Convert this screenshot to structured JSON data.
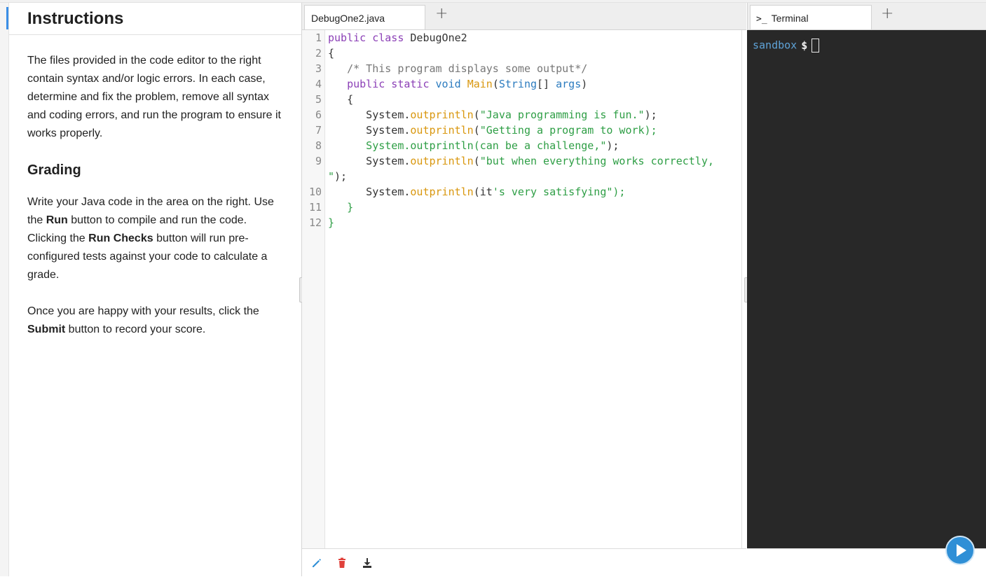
{
  "instructions": {
    "title": "Instructions",
    "intro": "The files provided in the code editor to the right contain syntax and/or logic errors. In each case, determine and fix the problem, remove all syntax and coding errors, and run the program to ensure it works properly.",
    "grading_title": "Grading",
    "grading_p1_a": "Write your Java code in the area on the right. Use the ",
    "grading_p1_run": "Run",
    "grading_p1_b": " button to compile and run the code. Clicking the ",
    "grading_p1_checks": "Run Checks",
    "grading_p1_c": " button will run pre-configured tests against your code to calculate a grade.",
    "grading_p2_a": "Once you are happy with your results, click the ",
    "grading_p2_submit": "Submit",
    "grading_p2_b": " button to record your score."
  },
  "editor": {
    "tab_label": "DebugOne2.java",
    "add_tab": "+",
    "lines": [
      {
        "n": "1",
        "tokens": [
          {
            "c": "kw",
            "t": "public class "
          },
          {
            "c": "pl",
            "t": "DebugOne2"
          }
        ]
      },
      {
        "n": "2",
        "tokens": [
          {
            "c": "pl",
            "t": "{"
          }
        ]
      },
      {
        "n": "3",
        "tokens": [
          {
            "c": "cm",
            "t": "   /* This program displays some output*/"
          }
        ]
      },
      {
        "n": "4",
        "tokens": [
          {
            "c": "kw",
            "t": "   public static "
          },
          {
            "c": "ty",
            "t": "void "
          },
          {
            "c": "fn",
            "t": "Main"
          },
          {
            "c": "pl",
            "t": "("
          },
          {
            "c": "ty",
            "t": "String"
          },
          {
            "c": "pl",
            "t": "[] "
          },
          {
            "c": "ty",
            "t": "args"
          },
          {
            "c": "pl",
            "t": ")"
          }
        ]
      },
      {
        "n": "5",
        "tokens": [
          {
            "c": "pl",
            "t": "   {"
          }
        ]
      },
      {
        "n": "6",
        "tokens": [
          {
            "c": "pl",
            "t": "      System."
          },
          {
            "c": "fn",
            "t": "outprintln"
          },
          {
            "c": "pl",
            "t": "("
          },
          {
            "c": "st",
            "t": "\"Java programming is fun.\""
          },
          {
            "c": "pl",
            "t": ");"
          }
        ]
      },
      {
        "n": "7",
        "tokens": [
          {
            "c": "pl",
            "t": "      System."
          },
          {
            "c": "fn",
            "t": "outprintln"
          },
          {
            "c": "pl",
            "t": "("
          },
          {
            "c": "st",
            "t": "\"Getting a program to work);"
          }
        ]
      },
      {
        "n": "8",
        "tokens": [
          {
            "c": "st",
            "t": "      System.outprintln(can be a challenge,\""
          },
          {
            "c": "pl",
            "t": ");"
          }
        ]
      },
      {
        "n": "9",
        "tokens": [
          {
            "c": "pl",
            "t": "      System."
          },
          {
            "c": "fn",
            "t": "outprintln"
          },
          {
            "c": "pl",
            "t": "("
          },
          {
            "c": "st",
            "t": "\"but when everything works correctly,"
          }
        ]
      },
      {
        "n": "",
        "tokens": [
          {
            "c": "st",
            "t": "\""
          },
          {
            "c": "pl",
            "t": ");"
          }
        ]
      },
      {
        "n": "10",
        "tokens": [
          {
            "c": "pl",
            "t": "      System."
          },
          {
            "c": "fn",
            "t": "outprintln"
          },
          {
            "c": "pl",
            "t": "(it"
          },
          {
            "c": "st",
            "t": "'s very satisfying\");"
          }
        ]
      },
      {
        "n": "11",
        "tokens": [
          {
            "c": "st",
            "t": "   }"
          }
        ]
      },
      {
        "n": "12",
        "tokens": [
          {
            "c": "st",
            "t": "}"
          }
        ]
      }
    ],
    "footer_icons": [
      "pencil-icon",
      "trash-icon",
      "download-icon"
    ]
  },
  "terminal": {
    "tab_label": "Terminal",
    "tab_icon": ">_",
    "add_tab": "+",
    "prompt_host": "sandbox",
    "prompt_symbol": "$"
  },
  "colors": {
    "accent": "#2f8fd6",
    "terminal_bg": "#282828",
    "keyword": "#8b3fb6",
    "type": "#2b7bbf",
    "function": "#d9970e",
    "string": "#2e9e45",
    "delete": "#e0403a"
  }
}
